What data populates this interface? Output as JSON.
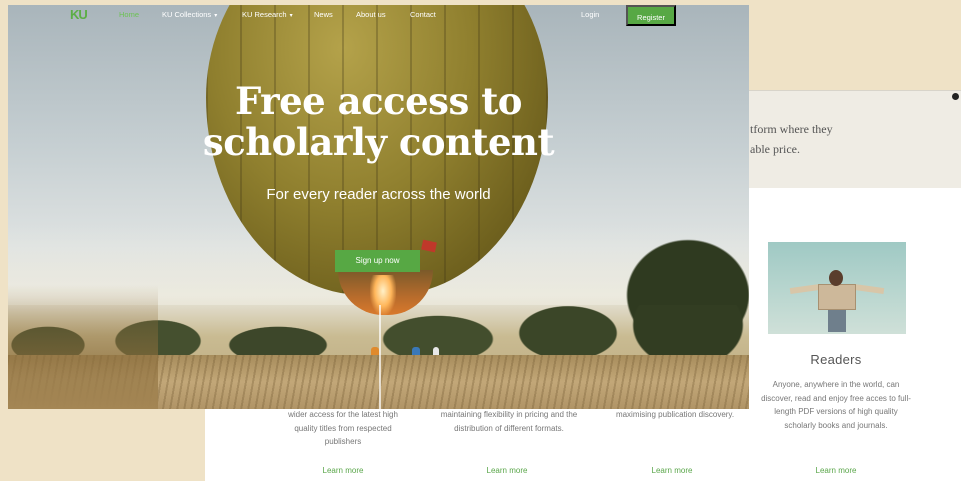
{
  "nav": {
    "logo": "KU",
    "items": [
      {
        "label": "Home"
      },
      {
        "label": "KU Collections"
      },
      {
        "label": "KU Research"
      },
      {
        "label": "News"
      },
      {
        "label": "About us"
      },
      {
        "label": "Contact"
      }
    ],
    "login": "Login",
    "register": "Register",
    "caret": "▾",
    "active_color": "#6cc253"
  },
  "hero": {
    "title_line1": "Free access to",
    "title_line2": "scholarly content",
    "subtitle": "For every reader across the world",
    "signup": "Sign up now"
  },
  "about": {
    "text_line1": "tform where they",
    "text_line2": "able price."
  },
  "columns": [
    {
      "text": "wider access for the latest high quality titles from respected publishers",
      "learn_more": "Learn more"
    },
    {
      "text": "maintaining flexibility in pricing and the distribution of different formats.",
      "learn_more": "Learn more"
    },
    {
      "text": "maximising publication discovery.",
      "learn_more": "Learn more"
    }
  ],
  "readers": {
    "title": "Readers",
    "text": "Anyone, anywhere in the world, can discover, read and enjoy free acces to full-length PDF versions of high quality scholarly books and journals.",
    "learn_more": "Learn more"
  },
  "colors": {
    "accent": "#57a844",
    "background": "#efe2c6"
  }
}
